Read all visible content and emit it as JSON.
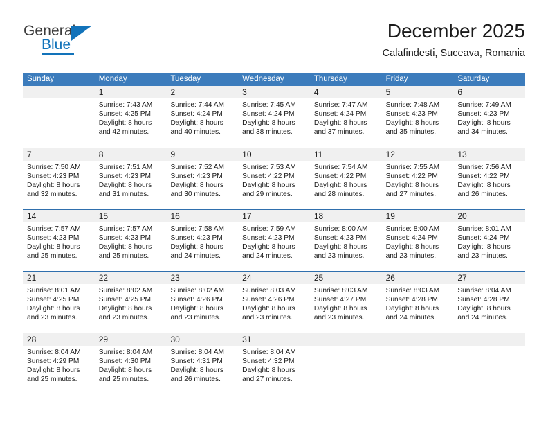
{
  "brand": {
    "name_primary": "General",
    "name_secondary": "Blue",
    "primary_color": "#3c3c3c",
    "accent_color": "#1273ba"
  },
  "header": {
    "month_title": "December 2025",
    "location": "Calafindesti, Suceava, Romania"
  },
  "calendar": {
    "header_bg": "#3c7cbc",
    "header_text_color": "#ffffff",
    "row_divider_color": "#2f6fad",
    "day_band_bg": "#f0f0f0",
    "weekdays": [
      "Sunday",
      "Monday",
      "Tuesday",
      "Wednesday",
      "Thursday",
      "Friday",
      "Saturday"
    ],
    "weeks": [
      [
        {
          "day": "",
          "lines": []
        },
        {
          "day": "1",
          "lines": [
            "Sunrise: 7:43 AM",
            "Sunset: 4:25 PM",
            "Daylight: 8 hours",
            "and 42 minutes."
          ]
        },
        {
          "day": "2",
          "lines": [
            "Sunrise: 7:44 AM",
            "Sunset: 4:24 PM",
            "Daylight: 8 hours",
            "and 40 minutes."
          ]
        },
        {
          "day": "3",
          "lines": [
            "Sunrise: 7:45 AM",
            "Sunset: 4:24 PM",
            "Daylight: 8 hours",
            "and 38 minutes."
          ]
        },
        {
          "day": "4",
          "lines": [
            "Sunrise: 7:47 AM",
            "Sunset: 4:24 PM",
            "Daylight: 8 hours",
            "and 37 minutes."
          ]
        },
        {
          "day": "5",
          "lines": [
            "Sunrise: 7:48 AM",
            "Sunset: 4:23 PM",
            "Daylight: 8 hours",
            "and 35 minutes."
          ]
        },
        {
          "day": "6",
          "lines": [
            "Sunrise: 7:49 AM",
            "Sunset: 4:23 PM",
            "Daylight: 8 hours",
            "and 34 minutes."
          ]
        }
      ],
      [
        {
          "day": "7",
          "lines": [
            "Sunrise: 7:50 AM",
            "Sunset: 4:23 PM",
            "Daylight: 8 hours",
            "and 32 minutes."
          ]
        },
        {
          "day": "8",
          "lines": [
            "Sunrise: 7:51 AM",
            "Sunset: 4:23 PM",
            "Daylight: 8 hours",
            "and 31 minutes."
          ]
        },
        {
          "day": "9",
          "lines": [
            "Sunrise: 7:52 AM",
            "Sunset: 4:23 PM",
            "Daylight: 8 hours",
            "and 30 minutes."
          ]
        },
        {
          "day": "10",
          "lines": [
            "Sunrise: 7:53 AM",
            "Sunset: 4:22 PM",
            "Daylight: 8 hours",
            "and 29 minutes."
          ]
        },
        {
          "day": "11",
          "lines": [
            "Sunrise: 7:54 AM",
            "Sunset: 4:22 PM",
            "Daylight: 8 hours",
            "and 28 minutes."
          ]
        },
        {
          "day": "12",
          "lines": [
            "Sunrise: 7:55 AM",
            "Sunset: 4:22 PM",
            "Daylight: 8 hours",
            "and 27 minutes."
          ]
        },
        {
          "day": "13",
          "lines": [
            "Sunrise: 7:56 AM",
            "Sunset: 4:22 PM",
            "Daylight: 8 hours",
            "and 26 minutes."
          ]
        }
      ],
      [
        {
          "day": "14",
          "lines": [
            "Sunrise: 7:57 AM",
            "Sunset: 4:23 PM",
            "Daylight: 8 hours",
            "and 25 minutes."
          ]
        },
        {
          "day": "15",
          "lines": [
            "Sunrise: 7:57 AM",
            "Sunset: 4:23 PM",
            "Daylight: 8 hours",
            "and 25 minutes."
          ]
        },
        {
          "day": "16",
          "lines": [
            "Sunrise: 7:58 AM",
            "Sunset: 4:23 PM",
            "Daylight: 8 hours",
            "and 24 minutes."
          ]
        },
        {
          "day": "17",
          "lines": [
            "Sunrise: 7:59 AM",
            "Sunset: 4:23 PM",
            "Daylight: 8 hours",
            "and 24 minutes."
          ]
        },
        {
          "day": "18",
          "lines": [
            "Sunrise: 8:00 AM",
            "Sunset: 4:23 PM",
            "Daylight: 8 hours",
            "and 23 minutes."
          ]
        },
        {
          "day": "19",
          "lines": [
            "Sunrise: 8:00 AM",
            "Sunset: 4:24 PM",
            "Daylight: 8 hours",
            "and 23 minutes."
          ]
        },
        {
          "day": "20",
          "lines": [
            "Sunrise: 8:01 AM",
            "Sunset: 4:24 PM",
            "Daylight: 8 hours",
            "and 23 minutes."
          ]
        }
      ],
      [
        {
          "day": "21",
          "lines": [
            "Sunrise: 8:01 AM",
            "Sunset: 4:25 PM",
            "Daylight: 8 hours",
            "and 23 minutes."
          ]
        },
        {
          "day": "22",
          "lines": [
            "Sunrise: 8:02 AM",
            "Sunset: 4:25 PM",
            "Daylight: 8 hours",
            "and 23 minutes."
          ]
        },
        {
          "day": "23",
          "lines": [
            "Sunrise: 8:02 AM",
            "Sunset: 4:26 PM",
            "Daylight: 8 hours",
            "and 23 minutes."
          ]
        },
        {
          "day": "24",
          "lines": [
            "Sunrise: 8:03 AM",
            "Sunset: 4:26 PM",
            "Daylight: 8 hours",
            "and 23 minutes."
          ]
        },
        {
          "day": "25",
          "lines": [
            "Sunrise: 8:03 AM",
            "Sunset: 4:27 PM",
            "Daylight: 8 hours",
            "and 23 minutes."
          ]
        },
        {
          "day": "26",
          "lines": [
            "Sunrise: 8:03 AM",
            "Sunset: 4:28 PM",
            "Daylight: 8 hours",
            "and 24 minutes."
          ]
        },
        {
          "day": "27",
          "lines": [
            "Sunrise: 8:04 AM",
            "Sunset: 4:28 PM",
            "Daylight: 8 hours",
            "and 24 minutes."
          ]
        }
      ],
      [
        {
          "day": "28",
          "lines": [
            "Sunrise: 8:04 AM",
            "Sunset: 4:29 PM",
            "Daylight: 8 hours",
            "and 25 minutes."
          ]
        },
        {
          "day": "29",
          "lines": [
            "Sunrise: 8:04 AM",
            "Sunset: 4:30 PM",
            "Daylight: 8 hours",
            "and 25 minutes."
          ]
        },
        {
          "day": "30",
          "lines": [
            "Sunrise: 8:04 AM",
            "Sunset: 4:31 PM",
            "Daylight: 8 hours",
            "and 26 minutes."
          ]
        },
        {
          "day": "31",
          "lines": [
            "Sunrise: 8:04 AM",
            "Sunset: 4:32 PM",
            "Daylight: 8 hours",
            "and 27 minutes."
          ]
        },
        {
          "day": "",
          "lines": []
        },
        {
          "day": "",
          "lines": []
        },
        {
          "day": "",
          "lines": []
        }
      ]
    ]
  }
}
